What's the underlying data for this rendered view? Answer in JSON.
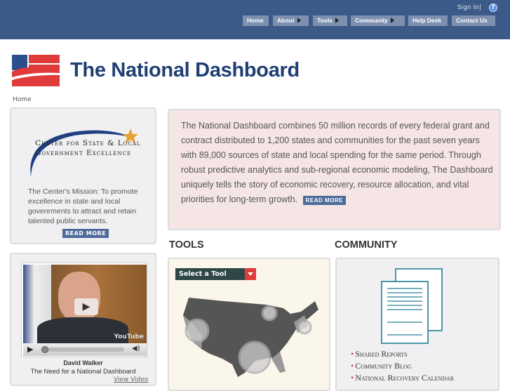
{
  "header": {
    "sign_in": "Sign In|",
    "help_icon": "question-icon",
    "nav": [
      {
        "label": "Home"
      },
      {
        "label": "About",
        "arrow": true
      },
      {
        "label": "Tools",
        "arrow": true
      },
      {
        "label": "Community",
        "arrow": true
      },
      {
        "label": "Help Desk"
      },
      {
        "label": "Contact Us"
      }
    ]
  },
  "brand": {
    "title": "The National Dashboard"
  },
  "breadcrumb": "Home",
  "center_promo": {
    "org": "Center for State & Local Government Excellence",
    "mission": "The Center's Mission: To promote excellence in state and local govenrments to attract and retain talented public servants.",
    "read_more": "READ MORE"
  },
  "intro": {
    "text": "The National Dashboard combines 50 million records of every federal grant and contract distributed to 1,200 states and communities for the past seven years with 89,000 sources of state and local spending for the same period. Through robust predictive analytics and sub-regional economic modeling, The Dashboard uniquely tells the story of economic recovery, resource allocation, and vital priorities for long-term growth.",
    "read_more": "READ MORE"
  },
  "video": {
    "name": "David Walker",
    "caption": "The Need for a National Dashboard",
    "view": "View Video",
    "watermark": "YouTube"
  },
  "tools": {
    "heading": "TOOLS",
    "select": "Select a Tool"
  },
  "community": {
    "heading": "COMMUNITY",
    "links": [
      "Shared Reports",
      "Community Blog",
      "National Recovery Calendar"
    ]
  },
  "colors": {
    "header": "#3b5a88",
    "brand": "#1f3f74",
    "accent_red": "#e03a3a"
  }
}
